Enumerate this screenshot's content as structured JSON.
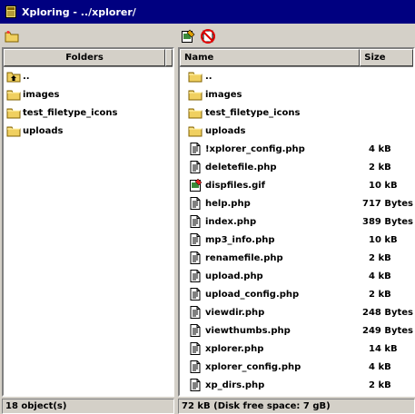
{
  "window": {
    "title": "Xploring - ../xplorer/"
  },
  "left_panel": {
    "header": "Folders",
    "items": [
      {
        "label": "..",
        "icon": "folder-up-icon"
      },
      {
        "label": "images",
        "icon": "folder-icon"
      },
      {
        "label": "test_filetype_icons",
        "icon": "folder-icon"
      },
      {
        "label": "uploads",
        "icon": "folder-icon"
      }
    ]
  },
  "right_panel": {
    "columns": {
      "name": "Name",
      "size": "Size"
    },
    "files": [
      {
        "name": "..",
        "size": "",
        "icon": "folder-icon"
      },
      {
        "name": "images",
        "size": "",
        "icon": "folder-icon"
      },
      {
        "name": "test_filetype_icons",
        "size": "",
        "icon": "folder-icon"
      },
      {
        "name": "uploads",
        "size": "",
        "icon": "folder-icon"
      },
      {
        "name": "!xplorer_config.php",
        "size": "4 kB",
        "icon": "file-icon"
      },
      {
        "name": "deletefile.php",
        "size": "2 kB",
        "icon": "file-icon"
      },
      {
        "name": "dispfiles.gif",
        "size": "10 kB",
        "icon": "image-file-icon"
      },
      {
        "name": "help.php",
        "size": "717 Bytes",
        "icon": "file-icon"
      },
      {
        "name": "index.php",
        "size": "389 Bytes",
        "icon": "file-icon"
      },
      {
        "name": "mp3_info.php",
        "size": "10 kB",
        "icon": "file-icon"
      },
      {
        "name": "renamefile.php",
        "size": "2 kB",
        "icon": "file-icon"
      },
      {
        "name": "upload.php",
        "size": "4 kB",
        "icon": "file-icon"
      },
      {
        "name": "upload_config.php",
        "size": "2 kB",
        "icon": "file-icon"
      },
      {
        "name": "viewdir.php",
        "size": "248 Bytes",
        "icon": "file-icon"
      },
      {
        "name": "viewthumbs.php",
        "size": "249 Bytes",
        "icon": "file-icon"
      },
      {
        "name": "xplorer.php",
        "size": "14 kB",
        "icon": "file-icon"
      },
      {
        "name": "xplorer_config.php",
        "size": "4 kB",
        "icon": "file-icon"
      },
      {
        "name": "xp_dirs.php",
        "size": "2 kB",
        "icon": "file-icon"
      }
    ]
  },
  "status": {
    "left": "18 object(s)",
    "right": "72 kB (Disk free space: 7 gB)"
  },
  "colors": {
    "titlebar": "#000080",
    "folder": "#f0d060",
    "window_bg": "#d4d0c8"
  }
}
